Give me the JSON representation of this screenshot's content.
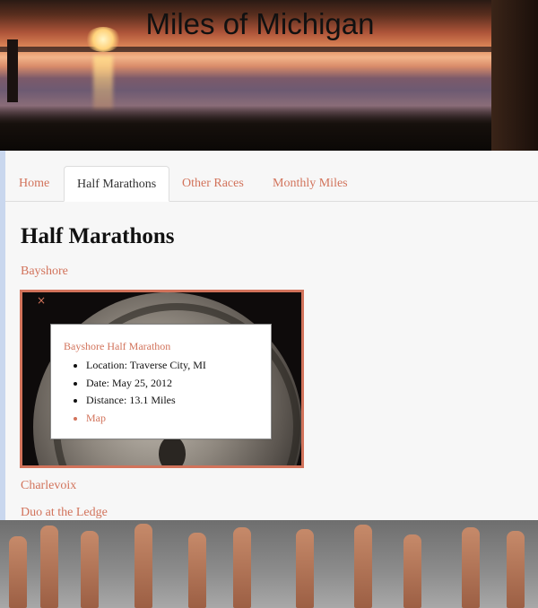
{
  "site": {
    "title": "Miles of Michigan"
  },
  "tabs": [
    {
      "label": "Home",
      "active": false
    },
    {
      "label": "Half Marathons",
      "active": true
    },
    {
      "label": "Other Races",
      "active": false
    },
    {
      "label": "Monthly Miles",
      "active": false
    }
  ],
  "main": {
    "heading": "Half Marathons",
    "races": [
      "Bayshore",
      "Charlevoix",
      "Duo at the Ledge"
    ]
  },
  "popup": {
    "close_symbol": "×",
    "title": "Bayshore Half Marathon",
    "location": "Location: Traverse City, MI",
    "date": "Date: May 25, 2012",
    "distance": "Distance: 13.1 Miles",
    "map_label": "Map"
  },
  "colors": {
    "accent": "#d2735b",
    "text": "#111111",
    "tab_border": "#dddddd"
  }
}
